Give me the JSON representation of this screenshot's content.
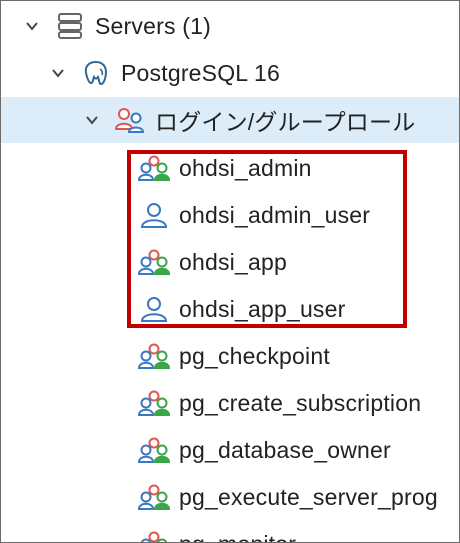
{
  "tree": {
    "servers": {
      "label": "Servers (1)",
      "icon": "servers-icon"
    },
    "server": {
      "label": "PostgreSQL 16",
      "icon": "elephant-icon"
    },
    "login_roles": {
      "label": "ログイン/グループロール",
      "icon": "group-role-icon"
    },
    "roles": [
      {
        "label": "ohdsi_admin",
        "icon": "group-role-icon"
      },
      {
        "label": "ohdsi_admin_user",
        "icon": "user-role-icon"
      },
      {
        "label": "ohdsi_app",
        "icon": "group-role-icon"
      },
      {
        "label": "ohdsi_app_user",
        "icon": "user-role-icon"
      },
      {
        "label": "pg_checkpoint",
        "icon": "group-role-icon"
      },
      {
        "label": "pg_create_subscription",
        "icon": "group-role-icon"
      },
      {
        "label": "pg_database_owner",
        "icon": "group-role-icon"
      },
      {
        "label": "pg_execute_server_prog",
        "icon": "group-role-icon"
      },
      {
        "label": "pg_monitor",
        "icon": "group-role-icon"
      }
    ]
  },
  "colors": {
    "selection": "#dcecf8",
    "highlight": "#c00000",
    "role_red": "#e0574f",
    "role_green": "#3aa64a",
    "role_blue": "#3a78c3"
  }
}
